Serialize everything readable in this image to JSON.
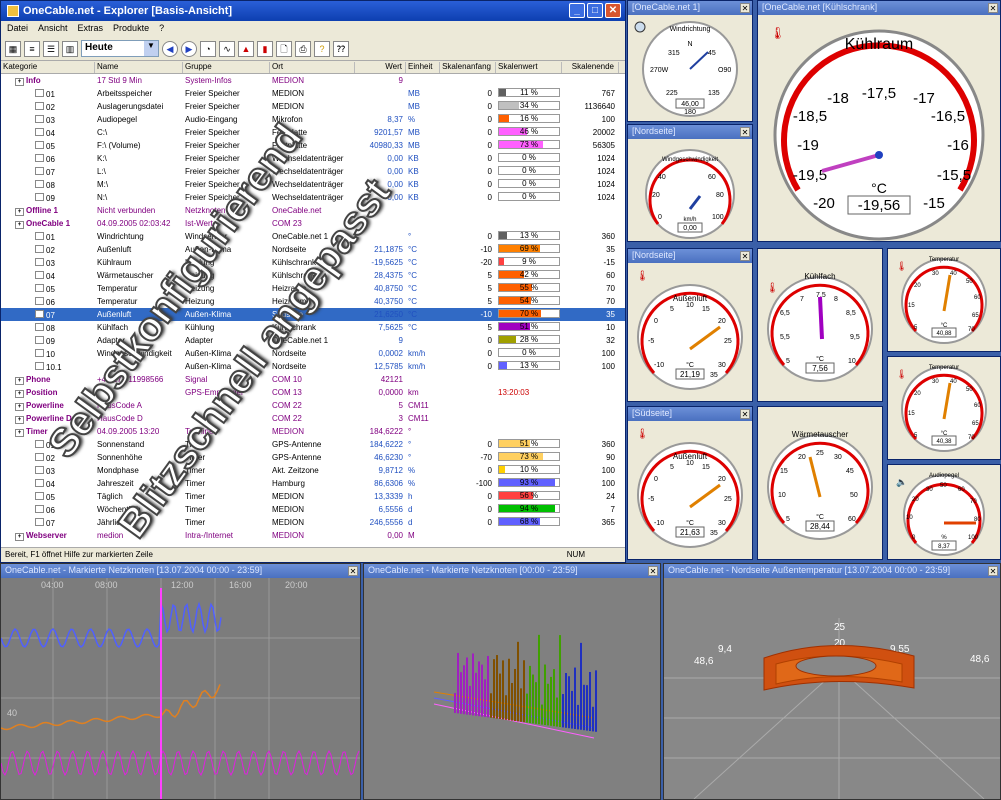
{
  "main": {
    "title": "OneCable.net - Explorer [Basis-Ansicht]",
    "menu": [
      "Datei",
      "Ansicht",
      "Extras",
      "Produkte",
      "?"
    ],
    "period": "Heute",
    "columns": [
      "Kategorie",
      "Name",
      "Gruppe",
      "Ort",
      "Wert",
      "Einheit",
      "Skalenanfang",
      "Skalenwert",
      "Skalenende"
    ],
    "status": "Bereit, F1 öffnet Hilfe zur markierten Zeile",
    "num": "NUM",
    "rows": [
      {
        "k": "Info",
        "n": "17 Std 9 Min",
        "g": "System-Infos",
        "o": "MEDION",
        "w": "9",
        "e": "",
        "a": "",
        "b": "",
        "be": "",
        "bc": "",
        "t": "grp"
      },
      {
        "k": "01",
        "n": "Arbeitsspeicher",
        "g": "Freier Speicher",
        "o": "MEDION",
        "w": "",
        "e": "MB",
        "a": "0",
        "b": "11 %",
        "be": "767",
        "bc": "#606060",
        "p": 11
      },
      {
        "k": "02",
        "n": "Auslagerungsdatei",
        "g": "Freier Speicher",
        "o": "MEDION",
        "w": "",
        "e": "MB",
        "a": "0",
        "b": "34 %",
        "be": "1136640",
        "bc": "#c0c0c0",
        "p": 34
      },
      {
        "k": "03",
        "n": "Audiopegel",
        "g": "Audio-Eingang",
        "o": "Mikrofon",
        "w": "8,37",
        "e": "%",
        "a": "0",
        "b": "16 %",
        "be": "100",
        "bc": "#ff6000",
        "p": 16
      },
      {
        "k": "04",
        "n": "C:\\",
        "g": "Freier Speicher",
        "o": "Festplatte",
        "w": "9201,57",
        "e": "MB",
        "a": "0",
        "b": "46 %",
        "be": "20002",
        "bc": "#ff60ff",
        "p": 46
      },
      {
        "k": "05",
        "n": "F:\\ (Volume)",
        "g": "Freier Speicher",
        "o": "Festplatte",
        "w": "40980,33",
        "e": "MB",
        "a": "0",
        "b": "73 %",
        "be": "56305",
        "bc": "#ff60ff",
        "p": 73
      },
      {
        "k": "06",
        "n": "K:\\",
        "g": "Freier Speicher",
        "o": "Wechseldatenträger",
        "w": "0,00",
        "e": "KB",
        "a": "0",
        "b": "0 %",
        "be": "1024",
        "bc": "#ccc",
        "p": 0
      },
      {
        "k": "07",
        "n": "L:\\",
        "g": "Freier Speicher",
        "o": "Wechseldatenträger",
        "w": "0,00",
        "e": "KB",
        "a": "0",
        "b": "0 %",
        "be": "1024",
        "bc": "#ccc",
        "p": 0
      },
      {
        "k": "08",
        "n": "M:\\",
        "g": "Freier Speicher",
        "o": "Wechseldatenträger",
        "w": "0,00",
        "e": "KB",
        "a": "0",
        "b": "0 %",
        "be": "1024",
        "bc": "#ccc",
        "p": 0
      },
      {
        "k": "09",
        "n": "N:\\",
        "g": "Freier Speicher",
        "o": "Wechseldatenträger",
        "w": "0,00",
        "e": "KB",
        "a": "0",
        "b": "0 %",
        "be": "1024",
        "bc": "#ccc",
        "p": 0
      },
      {
        "k": "Offline 1",
        "n": "Nicht verbunden",
        "g": "Netzknoten",
        "o": "OneCable.net",
        "w": "",
        "e": "",
        "a": "",
        "b": "",
        "be": "",
        "bc": "",
        "t": "grp"
      },
      {
        "k": "OneCable 1",
        "n": "04.09.2005 02:03:42",
        "g": "Ist-Werte",
        "o": "COM 23",
        "w": "",
        "e": "",
        "a": "",
        "b": "",
        "be": "",
        "bc": "",
        "t": "grp"
      },
      {
        "k": "01",
        "n": "Windrichtung",
        "g": "Windsensor",
        "o": "OneCable.net 1",
        "w": "",
        "e": "°",
        "a": "0",
        "b": "13 %",
        "be": "360",
        "bc": "#606060",
        "p": 13
      },
      {
        "k": "02",
        "n": "Außenluft",
        "g": "Außen-Klima",
        "o": "Nordseite",
        "w": "21,1875",
        "e": "°C",
        "a": "-10",
        "b": "69 %",
        "be": "35",
        "bc": "#ff8000",
        "p": 69
      },
      {
        "k": "03",
        "n": "Kühlraum",
        "g": "Kühlung",
        "o": "Kühlschrank",
        "w": "-19,5625",
        "e": "°C",
        "a": "-20",
        "b": "9 %",
        "be": "-15",
        "bc": "#ff4040",
        "p": 9
      },
      {
        "k": "04",
        "n": "Wärmetauscher",
        "g": "Heizung",
        "o": "Kühlschrank",
        "w": "28,4375",
        "e": "°C",
        "a": "5",
        "b": "42 %",
        "be": "60",
        "bc": "#ff6000",
        "p": 42
      },
      {
        "k": "05",
        "n": "Temperatur",
        "g": "Heizung",
        "o": "Heizraum",
        "w": "40,8750",
        "e": "°C",
        "a": "5",
        "b": "55 %",
        "be": "70",
        "bc": "#ff6000",
        "p": 55
      },
      {
        "k": "06",
        "n": "Temperatur",
        "g": "Heizung",
        "o": "Heizraum",
        "w": "40,3750",
        "e": "°C",
        "a": "5",
        "b": "54 %",
        "be": "70",
        "bc": "#ff6000",
        "p": 54
      },
      {
        "k": "07",
        "n": "Außenluft",
        "g": "Außen-Klima",
        "o": "Südseite",
        "w": "21,6250",
        "e": "°C",
        "a": "-10",
        "b": "70 %",
        "be": "35",
        "bc": "#ff6000",
        "p": 70,
        "t": "sel"
      },
      {
        "k": "08",
        "n": "Kühlfach",
        "g": "Kühlung",
        "o": "Kühlschrank",
        "w": "7,5625",
        "e": "°C",
        "a": "5",
        "b": "51 %",
        "be": "10",
        "bc": "#a000c0",
        "p": 51
      },
      {
        "k": "09",
        "n": "Adapter",
        "g": "Adapter",
        "o": "OneCable.net 1",
        "w": "9",
        "e": "",
        "a": "0",
        "b": "28 %",
        "be": "32",
        "bc": "#a0a000",
        "p": 28
      },
      {
        "k": "10",
        "n": "Windgeschwindigkeit",
        "g": "Außen-Klima",
        "o": "Nordseite",
        "w": "0,0002",
        "e": "km/h",
        "a": "0",
        "b": "0 %",
        "be": "100",
        "bc": "#ccc",
        "p": 0
      },
      {
        "k": "10.1",
        "n": "",
        "g": "Außen-Klima",
        "o": "Nordseite",
        "w": "12,5785",
        "e": "km/h",
        "a": "0",
        "b": "13 %",
        "be": "100",
        "bc": "#6060ff",
        "p": 13
      },
      {
        "k": "Phone",
        "n": "+49 171 11998566",
        "g": "Signal",
        "o": "COM 10",
        "w": "42121",
        "e": "",
        "a": "",
        "b": "",
        "be": "",
        "bc": "",
        "t": "grp"
      },
      {
        "k": "Position",
        "n": "",
        "g": "GPS-Empfänger",
        "o": "COM 13",
        "w": "0,0000",
        "e": "km",
        "a": "",
        "b": "13:20:03",
        "be": "",
        "bc": "",
        "t": "grp"
      },
      {
        "k": "Powerline",
        "n": "HausCode A",
        "g": "",
        "o": "COM 22",
        "w": "5",
        "e": "CM11",
        "a": "",
        "b": "",
        "be": "",
        "bc": "",
        "t": "grp"
      },
      {
        "k": "Powerline D",
        "n": "HausCode D",
        "g": "",
        "o": "COM 22",
        "w": "3",
        "e": "CM11",
        "a": "",
        "b": "",
        "be": "",
        "bc": "",
        "t": "grp"
      },
      {
        "k": "Timer",
        "n": "04.09.2005 13:20",
        "g": "Termine",
        "o": "MEDION",
        "w": "184,6222",
        "e": "°",
        "a": "",
        "b": "",
        "be": "",
        "bc": "",
        "t": "grp"
      },
      {
        "k": "01",
        "n": "Sonnenstand",
        "g": "Timer",
        "o": "GPS-Antenne",
        "w": "184,6222",
        "e": "°",
        "a": "0",
        "b": "51 %",
        "be": "360",
        "bc": "#ffd060",
        "p": 51
      },
      {
        "k": "02",
        "n": "Sonnenhöhe",
        "g": "Timer",
        "o": "GPS-Antenne",
        "w": "46,6230",
        "e": "°",
        "a": "-70",
        "b": "73 %",
        "be": "90",
        "bc": "#ffd060",
        "p": 73
      },
      {
        "k": "03",
        "n": "Mondphase",
        "g": "Timer",
        "o": "Akt. Zeitzone",
        "w": "9,8712",
        "e": "%",
        "a": "0",
        "b": "10 %",
        "be": "100",
        "bc": "#ffd000",
        "p": 10
      },
      {
        "k": "04",
        "n": "Jahreszeit",
        "g": "Timer",
        "o": "Hamburg",
        "w": "86,6306",
        "e": "%",
        "a": "-100",
        "b": "93 %",
        "be": "100",
        "bc": "#6060ff",
        "p": 93
      },
      {
        "k": "05",
        "n": "Täglich",
        "g": "Timer",
        "o": "MEDION",
        "w": "13,3339",
        "e": "h",
        "a": "0",
        "b": "56 %",
        "be": "24",
        "bc": "#ff4040",
        "p": 56
      },
      {
        "k": "06",
        "n": "Wöchentlich",
        "g": "Timer",
        "o": "MEDION",
        "w": "6,5556",
        "e": "d",
        "a": "0",
        "b": "94 %",
        "be": "7",
        "bc": "#00c000",
        "p": 94
      },
      {
        "k": "07",
        "n": "Jährlich",
        "g": "Timer",
        "o": "MEDION",
        "w": "246,5556",
        "e": "d",
        "a": "0",
        "b": "68 %",
        "be": "365",
        "bc": "#6060ff",
        "p": 68
      },
      {
        "k": "Webserver",
        "n": "medion",
        "g": "Intra-/Internet",
        "o": "MEDION",
        "w": "0,00",
        "e": "M",
        "a": "",
        "b": "",
        "be": "",
        "bc": "",
        "t": "grp"
      }
    ]
  },
  "gauges": {
    "g1": {
      "title": "[OneCable.net 1]",
      "label": "Windrichtung",
      "value": "46,00",
      "unit": "°"
    },
    "g2": {
      "title": "[OneCable.net [Kühlschrank]",
      "label": "Kühlraum",
      "value": "-19,56",
      "unit": "°C"
    },
    "g3": {
      "title": "[Nordseite]",
      "label": "Windgeschwindigkeit",
      "value": "0,00",
      "unit": "km/h"
    },
    "g4": {
      "title": "[Nordseite]",
      "label": "Außenluft",
      "value": "21,19",
      "unit": "°C"
    },
    "g5": {
      "title": "",
      "label": "Kühlfach",
      "value": "7,56",
      "unit": "°C"
    },
    "g6": {
      "title": "",
      "label": "Temperatur",
      "value": "40,88",
      "unit": "°C"
    },
    "g7": {
      "title": "[Südseite]",
      "label": "Außenluft",
      "value": "21,63",
      "unit": "°C"
    },
    "g8": {
      "title": "",
      "label": "Wärmetauscher",
      "value": "28,44",
      "unit": "°C"
    },
    "g9": {
      "title": "",
      "label": "Temperatur",
      "value": "40,38",
      "unit": "°C"
    },
    "g10": {
      "title": "",
      "label": "Audiopegel",
      "value": "8,37",
      "unit": "%"
    }
  },
  "bottom": {
    "p1": "OneCable.net - Markierte Netzknoten [13.07.2004 00:00 - 23:59]",
    "p2": "OneCable.net - Markierte Netzknoten [00:00 - 23:59]",
    "p3": "OneCable.net - Nordseite Außentemperatur [13.07.2004 00:00 - 23:59]",
    "times": [
      "04:00",
      "08:00",
      "12:00",
      "16:00",
      "20:00"
    ],
    "v40": "40",
    "p3labels": [
      "48,6",
      "9,4",
      "25",
      "20",
      "9,55",
      "48,6"
    ]
  },
  "watermark": {
    "l1": "Selbstkonfigurierend",
    "l2": "Blitzschnell angepasst"
  }
}
